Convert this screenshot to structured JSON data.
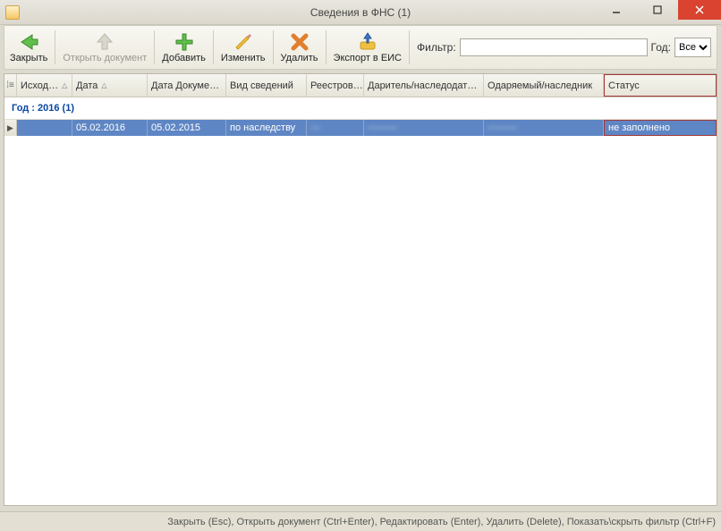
{
  "window": {
    "title": "Сведения в ФНС (1)"
  },
  "toolbar": {
    "close": "Закрыть",
    "open_doc": "Открыть документ",
    "add": "Добавить",
    "edit": "Изменить",
    "delete": "Удалить",
    "export": "Экспорт в ЕИС",
    "filter_label": "Фильтр:",
    "year_label": "Год:",
    "year_value": "Все"
  },
  "columns": {
    "outgoing": "Исход…",
    "date": "Дата",
    "doc_date": "Дата Докуме…",
    "type": "Вид сведений",
    "registry": "Реестров…",
    "donor": "Даритель/наследодат…",
    "recipient": "Одаряемый/наследник",
    "status": "Статус"
  },
  "group": {
    "label": "Год : 2016 (1)"
  },
  "rows": [
    {
      "outgoing": "",
      "date": "05.02.2016",
      "doc_date": "05.02.2015",
      "type": "по наследству",
      "registry": "—",
      "donor": "———",
      "recipient": "———",
      "status": "не заполнено"
    }
  ],
  "statusbar": {
    "text": "Закрыть (Esc), Открыть документ (Ctrl+Enter), Редактировать (Enter), Удалить (Delete), Показать\\скрыть фильтр (Ctrl+F)"
  }
}
